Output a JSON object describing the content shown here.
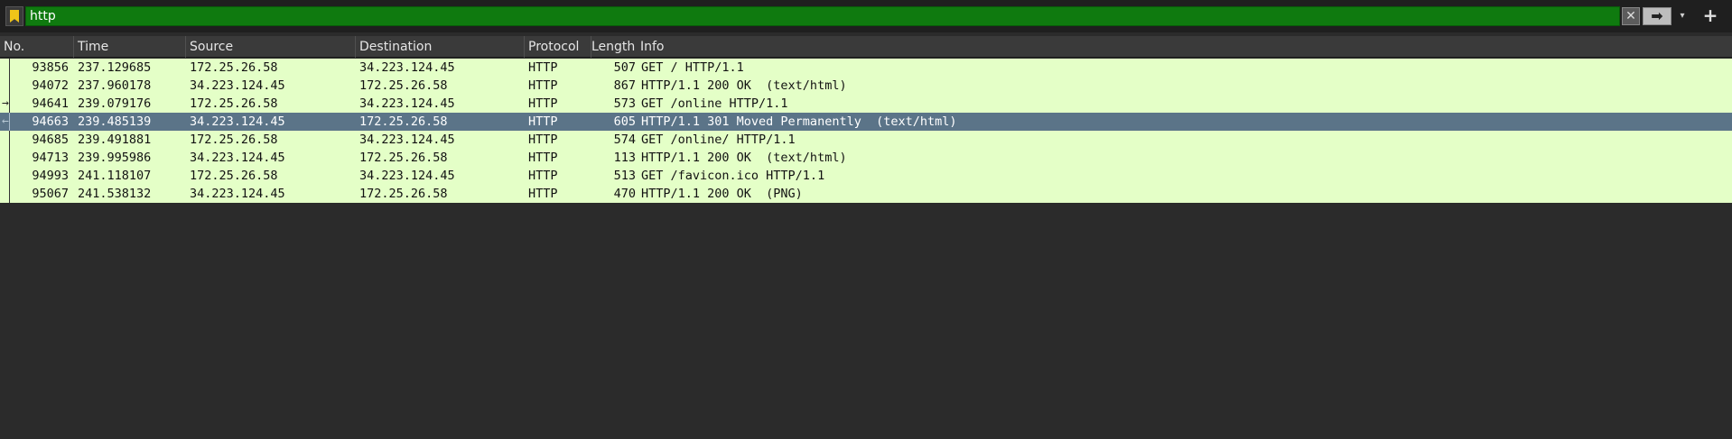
{
  "filter": {
    "value": "http",
    "bookmark_icon": "bookmark-icon",
    "clear_icon": "clear-icon",
    "clear_glyph": "✕",
    "apply_icon": "arrow-right-icon",
    "apply_glyph": "➡",
    "dropdown_icon": "chevron-down-icon",
    "dropdown_glyph": "▾",
    "add_icon": "plus-icon",
    "add_glyph": "+",
    "filter_bg_color": "#0f7a0f"
  },
  "columns": [
    "No.",
    "Time",
    "Source",
    "Destination",
    "Protocol",
    "Length",
    "Info"
  ],
  "packets": [
    {
      "no": "93856",
      "time": "237.129685",
      "src": "172.25.26.58",
      "dst": "34.223.124.45",
      "proto": "HTTP",
      "len": "507",
      "info": "GET / HTTP/1.1",
      "selected": false,
      "marker": ""
    },
    {
      "no": "94072",
      "time": "237.960178",
      "src": "34.223.124.45",
      "dst": "172.25.26.58",
      "proto": "HTTP",
      "len": "867",
      "info": "HTTP/1.1 200 OK  (text/html)",
      "selected": false,
      "marker": ""
    },
    {
      "no": "94641",
      "time": "239.079176",
      "src": "172.25.26.58",
      "dst": "34.223.124.45",
      "proto": "HTTP",
      "len": "573",
      "info": "GET /online HTTP/1.1",
      "selected": false,
      "marker": "→"
    },
    {
      "no": "94663",
      "time": "239.485139",
      "src": "34.223.124.45",
      "dst": "172.25.26.58",
      "proto": "HTTP",
      "len": "605",
      "info": "HTTP/1.1 301 Moved Permanently  (text/html)",
      "selected": true,
      "marker": "←"
    },
    {
      "no": "94685",
      "time": "239.491881",
      "src": "172.25.26.58",
      "dst": "34.223.124.45",
      "proto": "HTTP",
      "len": "574",
      "info": "GET /online/ HTTP/1.1",
      "selected": false,
      "marker": ""
    },
    {
      "no": "94713",
      "time": "239.995986",
      "src": "34.223.124.45",
      "dst": "172.25.26.58",
      "proto": "HTTP",
      "len": "113",
      "info": "HTTP/1.1 200 OK  (text/html)",
      "selected": false,
      "marker": ""
    },
    {
      "no": "94993",
      "time": "241.118107",
      "src": "172.25.26.58",
      "dst": "34.223.124.45",
      "proto": "HTTP",
      "len": "513",
      "info": "GET /favicon.ico HTTP/1.1",
      "selected": false,
      "marker": ""
    },
    {
      "no": "95067",
      "time": "241.538132",
      "src": "34.223.124.45",
      "dst": "172.25.26.58",
      "proto": "HTTP",
      "len": "470",
      "info": "HTTP/1.1 200 OK  (PNG)",
      "selected": false,
      "marker": ""
    }
  ],
  "colors": {
    "http_row_bg": "#e4ffc7",
    "selected_row_bg": "#5b7488",
    "background": "#2b2b2b"
  }
}
